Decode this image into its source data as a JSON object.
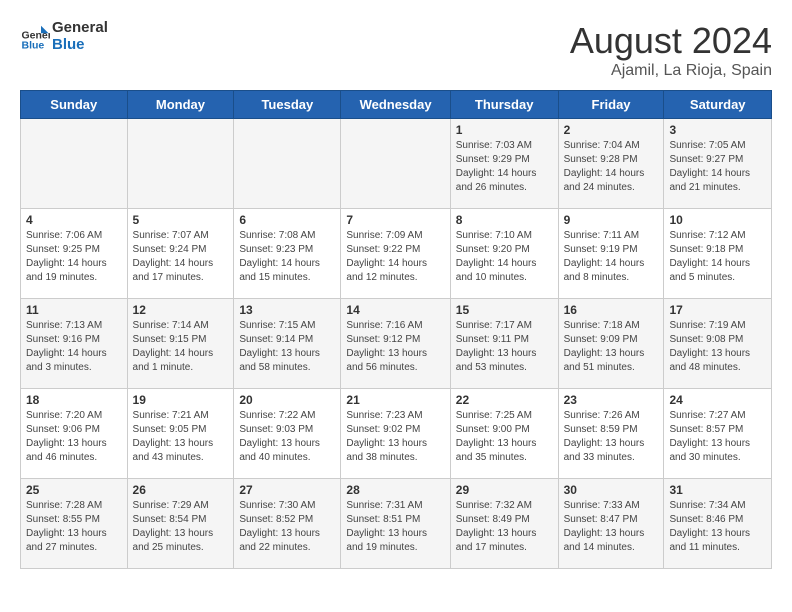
{
  "header": {
    "logo_text_general": "General",
    "logo_text_blue": "Blue",
    "month_year": "August 2024",
    "location": "Ajamil, La Rioja, Spain"
  },
  "weekdays": [
    "Sunday",
    "Monday",
    "Tuesday",
    "Wednesday",
    "Thursday",
    "Friday",
    "Saturday"
  ],
  "weeks": [
    [
      {
        "day": "",
        "info": ""
      },
      {
        "day": "",
        "info": ""
      },
      {
        "day": "",
        "info": ""
      },
      {
        "day": "",
        "info": ""
      },
      {
        "day": "1",
        "info": "Sunrise: 7:03 AM\nSunset: 9:29 PM\nDaylight: 14 hours and 26 minutes."
      },
      {
        "day": "2",
        "info": "Sunrise: 7:04 AM\nSunset: 9:28 PM\nDaylight: 14 hours and 24 minutes."
      },
      {
        "day": "3",
        "info": "Sunrise: 7:05 AM\nSunset: 9:27 PM\nDaylight: 14 hours and 21 minutes."
      }
    ],
    [
      {
        "day": "4",
        "info": "Sunrise: 7:06 AM\nSunset: 9:25 PM\nDaylight: 14 hours and 19 minutes."
      },
      {
        "day": "5",
        "info": "Sunrise: 7:07 AM\nSunset: 9:24 PM\nDaylight: 14 hours and 17 minutes."
      },
      {
        "day": "6",
        "info": "Sunrise: 7:08 AM\nSunset: 9:23 PM\nDaylight: 14 hours and 15 minutes."
      },
      {
        "day": "7",
        "info": "Sunrise: 7:09 AM\nSunset: 9:22 PM\nDaylight: 14 hours and 12 minutes."
      },
      {
        "day": "8",
        "info": "Sunrise: 7:10 AM\nSunset: 9:20 PM\nDaylight: 14 hours and 10 minutes."
      },
      {
        "day": "9",
        "info": "Sunrise: 7:11 AM\nSunset: 9:19 PM\nDaylight: 14 hours and 8 minutes."
      },
      {
        "day": "10",
        "info": "Sunrise: 7:12 AM\nSunset: 9:18 PM\nDaylight: 14 hours and 5 minutes."
      }
    ],
    [
      {
        "day": "11",
        "info": "Sunrise: 7:13 AM\nSunset: 9:16 PM\nDaylight: 14 hours and 3 minutes."
      },
      {
        "day": "12",
        "info": "Sunrise: 7:14 AM\nSunset: 9:15 PM\nDaylight: 14 hours and 1 minute."
      },
      {
        "day": "13",
        "info": "Sunrise: 7:15 AM\nSunset: 9:14 PM\nDaylight: 13 hours and 58 minutes."
      },
      {
        "day": "14",
        "info": "Sunrise: 7:16 AM\nSunset: 9:12 PM\nDaylight: 13 hours and 56 minutes."
      },
      {
        "day": "15",
        "info": "Sunrise: 7:17 AM\nSunset: 9:11 PM\nDaylight: 13 hours and 53 minutes."
      },
      {
        "day": "16",
        "info": "Sunrise: 7:18 AM\nSunset: 9:09 PM\nDaylight: 13 hours and 51 minutes."
      },
      {
        "day": "17",
        "info": "Sunrise: 7:19 AM\nSunset: 9:08 PM\nDaylight: 13 hours and 48 minutes."
      }
    ],
    [
      {
        "day": "18",
        "info": "Sunrise: 7:20 AM\nSunset: 9:06 PM\nDaylight: 13 hours and 46 minutes."
      },
      {
        "day": "19",
        "info": "Sunrise: 7:21 AM\nSunset: 9:05 PM\nDaylight: 13 hours and 43 minutes."
      },
      {
        "day": "20",
        "info": "Sunrise: 7:22 AM\nSunset: 9:03 PM\nDaylight: 13 hours and 40 minutes."
      },
      {
        "day": "21",
        "info": "Sunrise: 7:23 AM\nSunset: 9:02 PM\nDaylight: 13 hours and 38 minutes."
      },
      {
        "day": "22",
        "info": "Sunrise: 7:25 AM\nSunset: 9:00 PM\nDaylight: 13 hours and 35 minutes."
      },
      {
        "day": "23",
        "info": "Sunrise: 7:26 AM\nSunset: 8:59 PM\nDaylight: 13 hours and 33 minutes."
      },
      {
        "day": "24",
        "info": "Sunrise: 7:27 AM\nSunset: 8:57 PM\nDaylight: 13 hours and 30 minutes."
      }
    ],
    [
      {
        "day": "25",
        "info": "Sunrise: 7:28 AM\nSunset: 8:55 PM\nDaylight: 13 hours and 27 minutes."
      },
      {
        "day": "26",
        "info": "Sunrise: 7:29 AM\nSunset: 8:54 PM\nDaylight: 13 hours and 25 minutes."
      },
      {
        "day": "27",
        "info": "Sunrise: 7:30 AM\nSunset: 8:52 PM\nDaylight: 13 hours and 22 minutes."
      },
      {
        "day": "28",
        "info": "Sunrise: 7:31 AM\nSunset: 8:51 PM\nDaylight: 13 hours and 19 minutes."
      },
      {
        "day": "29",
        "info": "Sunrise: 7:32 AM\nSunset: 8:49 PM\nDaylight: 13 hours and 17 minutes."
      },
      {
        "day": "30",
        "info": "Sunrise: 7:33 AM\nSunset: 8:47 PM\nDaylight: 13 hours and 14 minutes."
      },
      {
        "day": "31",
        "info": "Sunrise: 7:34 AM\nSunset: 8:46 PM\nDaylight: 13 hours and 11 minutes."
      }
    ]
  ]
}
